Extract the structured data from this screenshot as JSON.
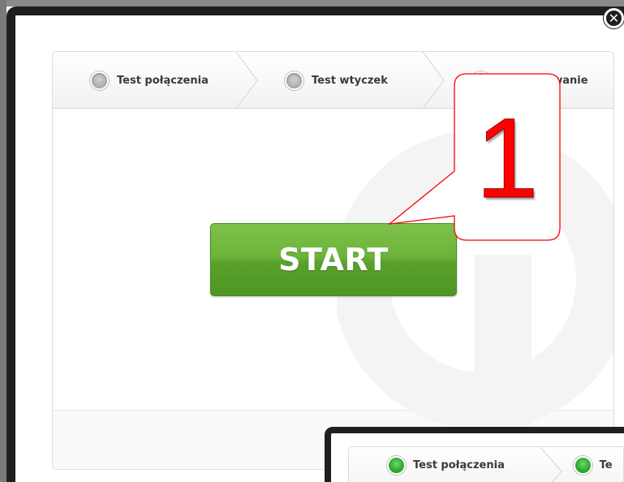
{
  "dialog": {
    "close_symbol": "✕",
    "steps": [
      {
        "label": "Test połączenia",
        "status": "pending"
      },
      {
        "label": "Test wtyczek",
        "status": "pending"
      },
      {
        "label": "Podsumowanie",
        "status": "pending"
      }
    ],
    "start_label": "START",
    "colors": {
      "start_button": "#6db43a",
      "step_dot_pending": "#b9b9b9",
      "frame": "#1f1f1f"
    }
  },
  "annotation": {
    "number": "1",
    "color": "#ff0000"
  },
  "second_dialog": {
    "steps": [
      {
        "label": "Test połączenia",
        "status": "done"
      },
      {
        "label": "Te",
        "status": "done"
      }
    ],
    "colors": {
      "step_dot_done": "#35b035"
    }
  }
}
